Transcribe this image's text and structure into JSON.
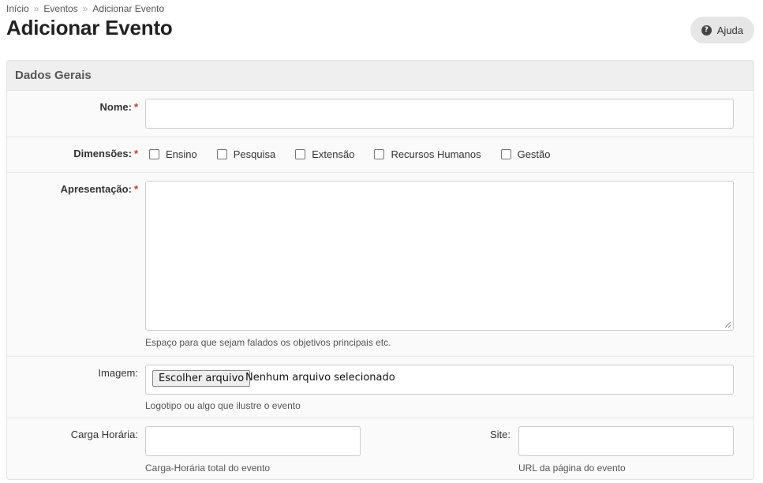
{
  "breadcrumb": {
    "items": [
      "Início",
      "Eventos",
      "Adicionar Evento"
    ],
    "separator": "»"
  },
  "page": {
    "title": "Adicionar Evento"
  },
  "help_button": {
    "label": "Ajuda",
    "icon": "question-circle-icon"
  },
  "panel": {
    "title": "Dados Gerais"
  },
  "form": {
    "nome": {
      "label": "Nome:",
      "required_mark": "*",
      "value": ""
    },
    "dimensoes": {
      "label": "Dimensões:",
      "required_mark": "*",
      "options": [
        "Ensino",
        "Pesquisa",
        "Extensão",
        "Recursos Humanos",
        "Gestão"
      ]
    },
    "apresentacao": {
      "label": "Apresentação:",
      "required_mark": "*",
      "value": "",
      "help": "Espaço para que sejam falados os objetivos principais etc."
    },
    "imagem": {
      "label": "Imagem:",
      "button_label": "Escolher arquivo",
      "status": "Nenhum arquivo selecionado",
      "help": "Logotipo ou algo que ilustre o evento"
    },
    "carga_horaria": {
      "label": "Carga Horária:",
      "value": "",
      "help": "Carga-Horária total do evento"
    },
    "site": {
      "label": "Site:",
      "value": "",
      "help": "URL da página do evento"
    }
  },
  "colors": {
    "required": "#c0392b",
    "panel_header_bg": "#efefef",
    "help_button_bg": "#e6e6e6"
  }
}
